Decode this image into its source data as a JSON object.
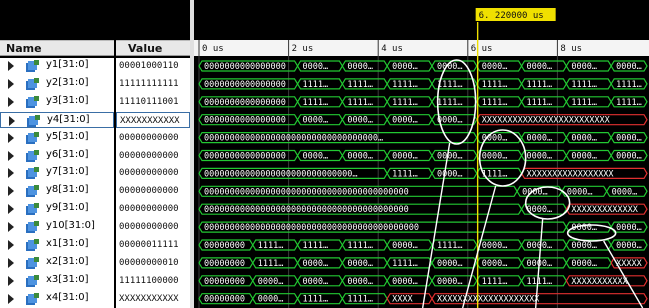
{
  "header": {
    "name_label": "Name",
    "value_label": "Value"
  },
  "cursor": {
    "label": "6. 220000  us",
    "time_us": 6.22
  },
  "timeline": {
    "ticks": [
      "0 us",
      "2 us",
      "4 us",
      "6 us",
      "8 us"
    ],
    "tick_times_us": [
      0,
      2,
      4,
      6,
      8
    ]
  },
  "signals": [
    {
      "name": "y1[31:0]",
      "value": "00001000110",
      "selected": false
    },
    {
      "name": "y2[31:0]",
      "value": "11111111111",
      "selected": false
    },
    {
      "name": "y3[31:0]",
      "value": "11110111001",
      "selected": false
    },
    {
      "name": "y4[31:0]",
      "value": "XXXXXXXXXXX",
      "selected": true
    },
    {
      "name": "y5[31:0]",
      "value": "00000000000",
      "selected": false
    },
    {
      "name": "y6[31:0]",
      "value": "00000000000",
      "selected": false
    },
    {
      "name": "y7[31:0]",
      "value": "00000000000",
      "selected": false
    },
    {
      "name": "y8[31:0]",
      "value": "00000000000",
      "selected": false
    },
    {
      "name": "y9[31:0]",
      "value": "00000000000",
      "selected": false
    },
    {
      "name": "y10[31:0]",
      "value": "00000000000",
      "selected": false
    },
    {
      "name": "x1[31:0]",
      "value": "00000011111",
      "selected": false
    },
    {
      "name": "x2[31:0]",
      "value": "00000000010",
      "selected": false
    },
    {
      "name": "x3[31:0]",
      "value": "11111100000",
      "selected": false
    },
    {
      "name": "x4[31:0]",
      "value": "XXXXXXXXXXX",
      "selected": false
    }
  ],
  "waves": [
    [
      [
        "0000000000000000…",
        0,
        2.2
      ],
      [
        "0000…",
        2.2,
        3.2
      ],
      [
        "0000…",
        3.2,
        4.2
      ],
      [
        "0000…",
        4.2,
        5.2
      ],
      [
        "0000…",
        5.2,
        6.2
      ],
      [
        "0000…",
        6.2,
        7.2
      ],
      [
        "0000…",
        7.2,
        8.2
      ],
      [
        "0000…",
        8.2,
        9.2
      ],
      [
        "0000…",
        9.2,
        10
      ]
    ],
    [
      [
        "0000000000000000…",
        0,
        2.2
      ],
      [
        "1111…",
        2.2,
        3.2
      ],
      [
        "1111…",
        3.2,
        4.2
      ],
      [
        "1111…",
        4.2,
        5.2
      ],
      [
        "1111…",
        5.2,
        6.2
      ],
      [
        "1111…",
        6.2,
        7.2
      ],
      [
        "1111…",
        7.2,
        8.2
      ],
      [
        "1111…",
        8.2,
        9.2
      ],
      [
        "1111…",
        9.2,
        10
      ]
    ],
    [
      [
        "0000000000000000…",
        0,
        2.2
      ],
      [
        "1111…",
        2.2,
        3.2
      ],
      [
        "1111…",
        3.2,
        4.2
      ],
      [
        "1111…",
        4.2,
        5.2
      ],
      [
        "1111…",
        5.2,
        6.2
      ],
      [
        "1111…",
        6.2,
        7.2
      ],
      [
        "1111…",
        7.2,
        8.2
      ],
      [
        "1111…",
        8.2,
        9.2
      ],
      [
        "1111…",
        9.2,
        10
      ]
    ],
    [
      [
        "0000000000000000…",
        0,
        2.2
      ],
      [
        "0000…",
        2.2,
        3.2
      ],
      [
        "0000…",
        3.2,
        4.2
      ],
      [
        "0000…",
        4.2,
        5.2
      ],
      [
        "0000…",
        5.2,
        6.2
      ],
      [
        "XXXXXXXXXXXXXXXXXXXXXXXXX",
        6.2,
        10,
        "x"
      ]
    ],
    [
      [
        "0000000000000000000000000000000000…",
        0,
        6.2
      ],
      [
        "0000…",
        6.2,
        7.2
      ],
      [
        "0000…",
        7.2,
        8.2
      ],
      [
        "0000…",
        8.2,
        9.2
      ],
      [
        "0000…",
        9.2,
        10
      ]
    ],
    [
      [
        "0000000000000000…",
        0,
        2.2
      ],
      [
        "0000…",
        2.2,
        3.2
      ],
      [
        "0000…",
        3.2,
        4.2
      ],
      [
        "0000…",
        4.2,
        5.2
      ],
      [
        "0000…",
        5.2,
        6.2
      ],
      [
        "0000…",
        6.2,
        7.2
      ],
      [
        "0000…",
        7.2,
        8.2
      ],
      [
        "0000…",
        8.2,
        9.2
      ],
      [
        "0000…",
        9.2,
        10
      ]
    ],
    [
      [
        "00000000000000000000000000000…",
        0,
        4.2
      ],
      [
        "1111…",
        4.2,
        5.2
      ],
      [
        "0000…",
        5.2,
        6.2
      ],
      [
        "1111…",
        6.2,
        7.2
      ],
      [
        "XXXXXXXXXXXXXXXXX",
        7.2,
        10,
        "x"
      ]
    ],
    [
      [
        "0000000000000000000000000000000000000000",
        0,
        7.1
      ],
      [
        "0000…",
        7.1,
        8.1
      ],
      [
        "0000…",
        8.1,
        9.1
      ],
      [
        "0000…",
        9.1,
        10
      ]
    ],
    [
      [
        "0000000000000000000000000000000000000000",
        0,
        7.2
      ],
      [
        "0000…",
        7.2,
        8.2
      ],
      [
        "XXXXXXXXXXXXX",
        8.2,
        10,
        "x"
      ]
    ],
    [
      [
        "000000000000000000000000000000000000000000",
        0,
        8.2
      ],
      [
        "0000…",
        8.2,
        9.2
      ],
      [
        "0000…",
        9.2,
        10
      ]
    ],
    [
      [
        "00000000…",
        0,
        1.2
      ],
      [
        "1111…",
        1.2,
        2.2
      ],
      [
        "1111…",
        2.2,
        3.2
      ],
      [
        "1111…",
        3.2,
        4.2
      ],
      [
        "0000…",
        4.2,
        5.2
      ],
      [
        "1111…",
        5.2,
        6.2
      ],
      [
        "0000…",
        6.2,
        7.2
      ],
      [
        "0000…",
        7.2,
        8.2
      ],
      [
        "0000…",
        8.2,
        9.2
      ],
      [
        "0000…",
        9.2,
        10
      ]
    ],
    [
      [
        "00000000…",
        0,
        1.2
      ],
      [
        "1111…",
        1.2,
        2.2
      ],
      [
        "0000…",
        2.2,
        3.2
      ],
      [
        "0000…",
        3.2,
        4.2
      ],
      [
        "1111…",
        4.2,
        5.2
      ],
      [
        "0000…",
        5.2,
        6.2
      ],
      [
        "0000…",
        6.2,
        7.2
      ],
      [
        "0000…",
        7.2,
        8.2
      ],
      [
        "0000…",
        8.2,
        9.2
      ],
      [
        "XXXXX",
        9.2,
        10,
        "x"
      ]
    ],
    [
      [
        "00000000…",
        0,
        1.2
      ],
      [
        "0000…",
        1.2,
        2.2
      ],
      [
        "0000…",
        2.2,
        3.2
      ],
      [
        "0000…",
        3.2,
        4.2
      ],
      [
        "0000…",
        4.2,
        5.2
      ],
      [
        "0000…",
        5.2,
        6.2
      ],
      [
        "1111…",
        6.2,
        7.2
      ],
      [
        "1111…",
        7.2,
        8.2
      ],
      [
        "XXXXXXXXXXX",
        8.2,
        10,
        "x"
      ]
    ],
    [
      [
        "00000000…",
        0,
        1.2
      ],
      [
        "0000…",
        1.2,
        2.2
      ],
      [
        "1111…",
        2.2,
        3.2
      ],
      [
        "1111…",
        3.2,
        4.2
      ],
      [
        "XXXX",
        4.2,
        5.2,
        "x"
      ],
      [
        "XXXXXXXXXXXXXXXXXXXX",
        5.2,
        10,
        "x"
      ]
    ]
  ],
  "colors": {
    "valid": "#22c832",
    "invalid": "#e03030",
    "cursor": "#f0e000",
    "grid": "#3c3c3c"
  }
}
